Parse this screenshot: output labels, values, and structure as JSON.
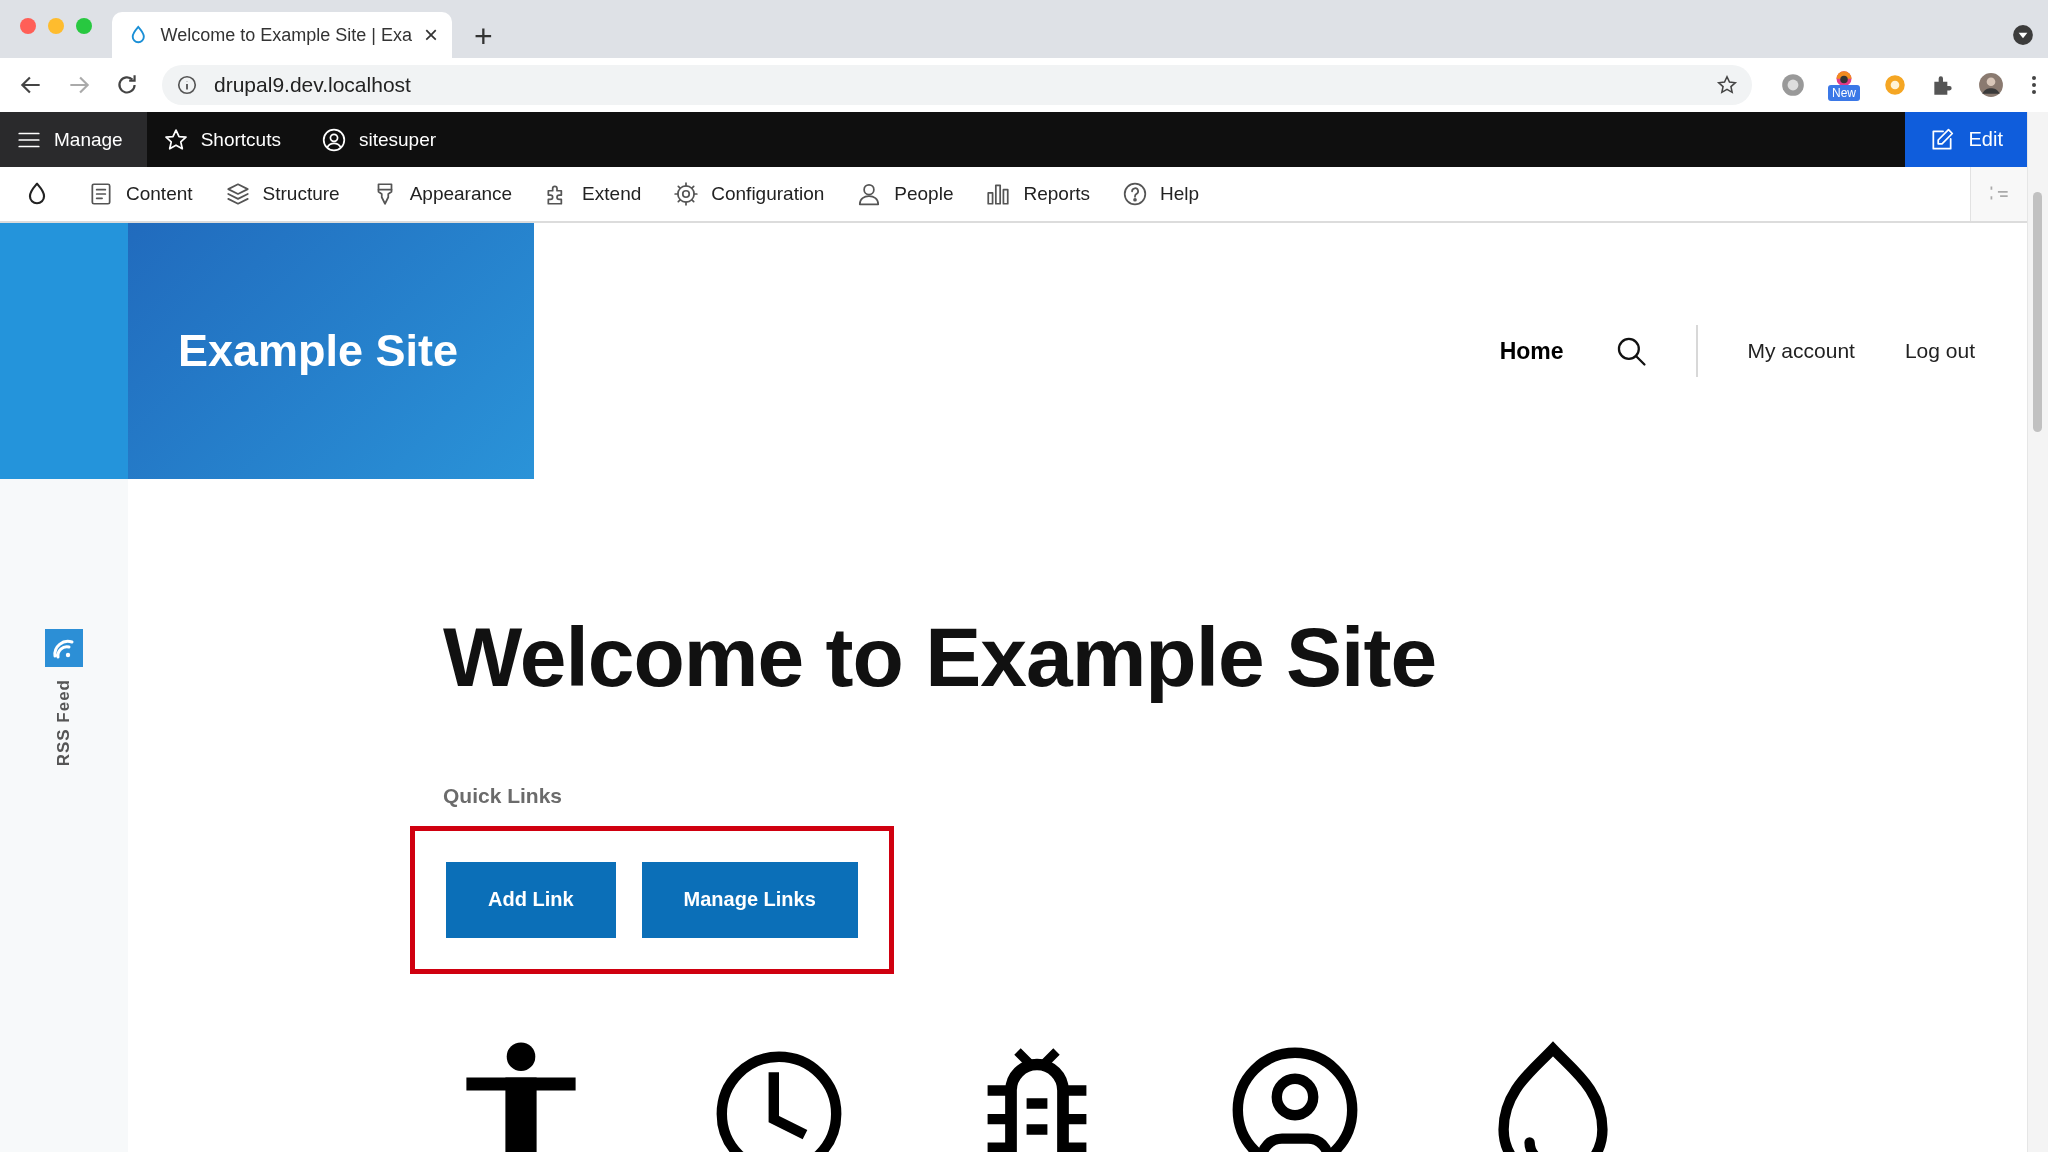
{
  "browser": {
    "tab": {
      "title": "Welcome to Example Site | Exa",
      "close": "×"
    },
    "new_tab": "+",
    "url": "drupal9.dev.localhost",
    "extension_badge": "New"
  },
  "toolbar": {
    "items": [
      {
        "label": "Manage",
        "kind": "menu",
        "selected": true
      },
      {
        "label": "Shortcuts",
        "kind": "star",
        "selected": false
      },
      {
        "label": "sitesuper",
        "kind": "user",
        "selected": false
      }
    ],
    "edit": "Edit"
  },
  "tray": {
    "items": [
      {
        "label": "Content",
        "kind": "content"
      },
      {
        "label": "Structure",
        "kind": "structure"
      },
      {
        "label": "Appearance",
        "kind": "appearance"
      },
      {
        "label": "Extend",
        "kind": "extend"
      },
      {
        "label": "Configuration",
        "kind": "configuration"
      },
      {
        "label": "People",
        "kind": "people"
      },
      {
        "label": "Reports",
        "kind": "reports"
      },
      {
        "label": "Help",
        "kind": "help"
      }
    ]
  },
  "site": {
    "name": "Example Site"
  },
  "nav": {
    "items": [
      {
        "label": "Home",
        "kind": "link",
        "selected": true
      },
      {
        "kind": "search"
      },
      {
        "label": "My account",
        "kind": "link",
        "selected": false
      },
      {
        "label": "Log out",
        "kind": "link",
        "selected": false
      }
    ]
  },
  "sidebar": {
    "rss": "RSS Feed"
  },
  "page": {
    "title": "Welcome to Example Site",
    "quick_links": {
      "heading": "Quick Links",
      "highlighted": true,
      "buttons": [
        "Add Link",
        "Manage Links"
      ]
    },
    "icons": [
      {
        "kind": "accessibility"
      },
      {
        "kind": "clock"
      },
      {
        "kind": "bug"
      },
      {
        "kind": "user"
      },
      {
        "kind": "drop"
      }
    ]
  }
}
